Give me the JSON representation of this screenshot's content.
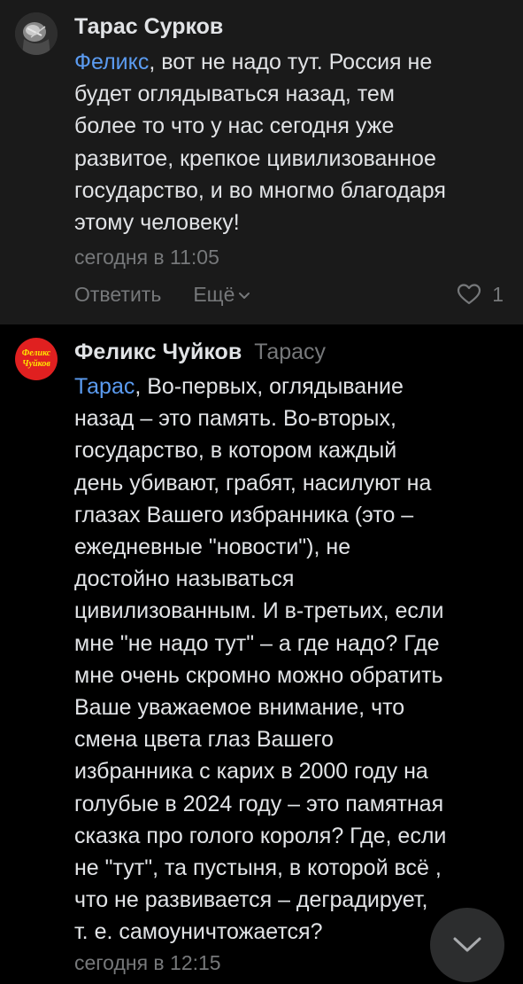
{
  "comments": [
    {
      "author": "Тарас Сурков",
      "mention": "Феликс",
      "text": ", вот не надо тут. Россия не\nбудет оглядываться назад, тем\nболее то что у нас сегодня уже\nразвитое, крепкое цивилизованное\nгосударство, и во многмо благодаря\nэтому человеку!",
      "timestamp": "сегодня в 11:05",
      "reply_label": "Ответить",
      "more_label": "Ещё",
      "likes": "1"
    },
    {
      "author": "Феликс Чуйков",
      "reply_to": "Тарасу",
      "avatar_text_line1": "Феликс",
      "avatar_text_line2": "Чуйков",
      "mention": "Тарас",
      "text": ", Во-первых, оглядывание\nназад – это память. Во-вторых,\nгосударство, в котором каждый\nдень убивают, грабят, насилуют на\nглазах Вашего избранника (это –\nежедневные \"новости\"), не\nдостойно называться\nцивилизованным. И в-третьих, если\nмне \"не надо тут\" – а где надо? Где\nмне очень скромно можно обратить\nВаше уважаемое внимание, что\nсмена цвета глаз Вашего\nизбранника с карих в 2000 году на\nголубые в 2024 году – это памятная\nсказка про голого короля? Где, если\nне \"тут\", та пустыня, в которой всё ,\nчто не развивается – деградирует,\nт. е. самоуничтожается?",
      "timestamp": "сегодня в 12:15"
    }
  ],
  "icons": {
    "like": "heart-outline-icon",
    "more": "chevron-down-small-icon",
    "scroll": "chevron-down-icon"
  },
  "colors": {
    "link": "#5b9bf0",
    "secondary_text": "#76787a",
    "primary_text": "#e1e3e6",
    "first_comment_bg": "#1a1a1a",
    "avatar_red": "#e02020"
  }
}
